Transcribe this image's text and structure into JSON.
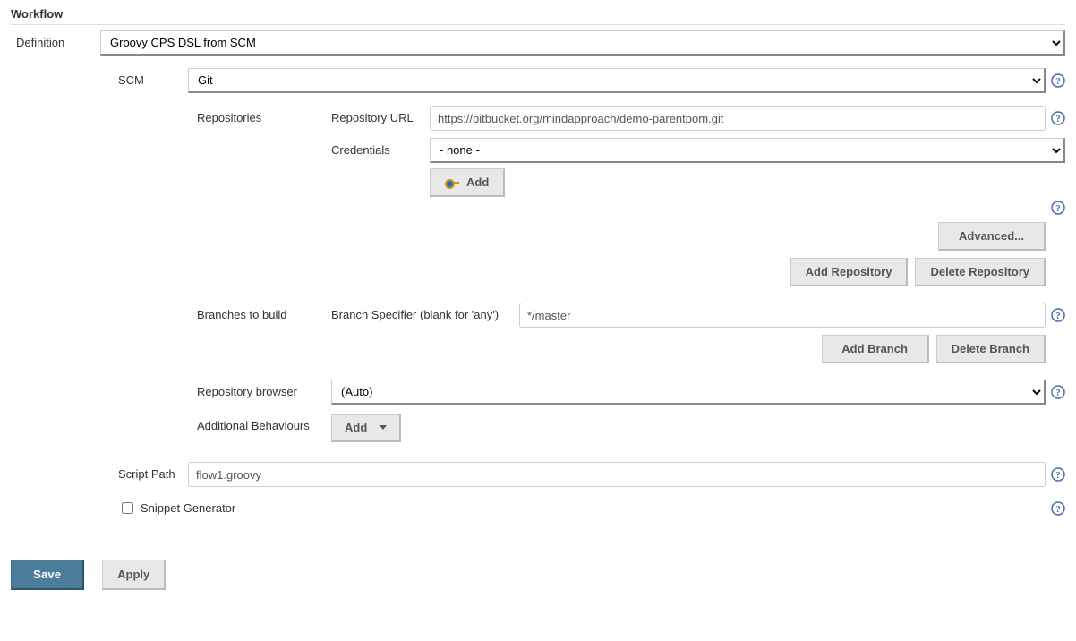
{
  "section_title": "Workflow",
  "definition": {
    "label": "Definition",
    "value": "Groovy CPS DSL from SCM"
  },
  "scm": {
    "label": "SCM",
    "value": "Git"
  },
  "repositories": {
    "label": "Repositories",
    "repo_url_label": "Repository URL",
    "repo_url_value": "https://bitbucket.org/mindapproach/demo-parentpom.git",
    "credentials_label": "Credentials",
    "credentials_value": "- none -",
    "add_btn": "Add",
    "advanced_btn": "Advanced...",
    "add_repo_btn": "Add Repository",
    "delete_repo_btn": "Delete Repository"
  },
  "branches": {
    "label": "Branches to build",
    "specifier_label": "Branch Specifier (blank for 'any')",
    "specifier_value": "*/master",
    "add_branch_btn": "Add Branch",
    "delete_branch_btn": "Delete Branch"
  },
  "repo_browser": {
    "label": "Repository browser",
    "value": "(Auto)"
  },
  "additional_behaviours": {
    "label": "Additional Behaviours",
    "add_btn": "Add"
  },
  "script_path": {
    "label": "Script Path",
    "value": "flow1.groovy"
  },
  "snippet_generator": {
    "label": "Snippet Generator",
    "checked": false
  },
  "footer": {
    "save": "Save",
    "apply": "Apply"
  }
}
